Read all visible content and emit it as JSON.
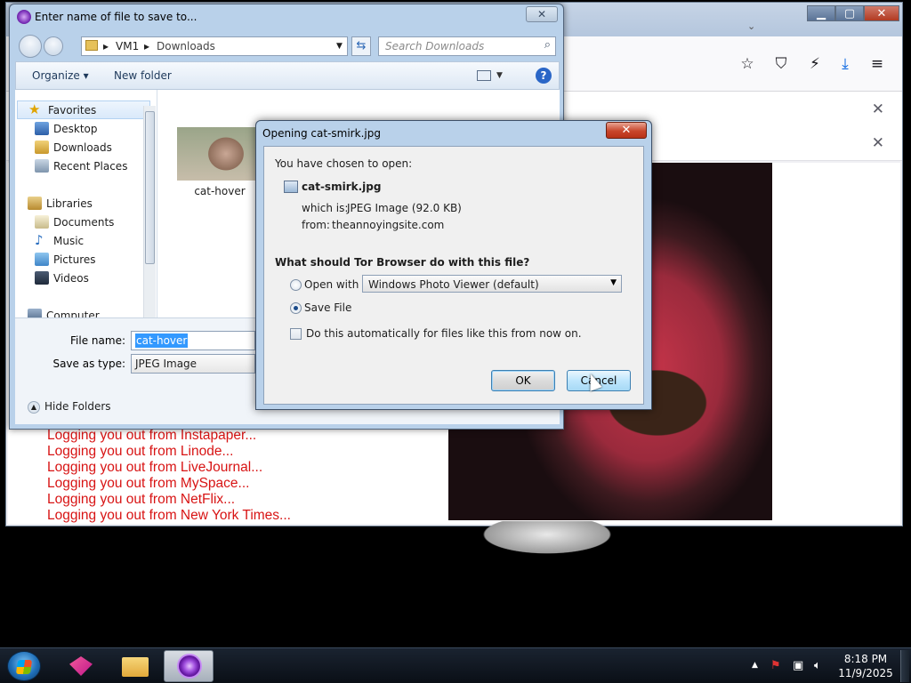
{
  "browser": {
    "toolbar_icons": [
      "star-icon",
      "shield-icon",
      "broom-icon",
      "download-icon",
      "menu-icon"
    ],
    "notification_close": "✕"
  },
  "page": {
    "log_lines": [
      "Logging you out from Instapaper...",
      "Logging you out from Linode...",
      "Logging you out from LiveJournal...",
      "Logging you out from MySpace...",
      "Logging you out from NetFlix...",
      "Logging you out from New York Times..."
    ]
  },
  "save_dialog": {
    "title": "Enter name of file to save to...",
    "breadcrumb": [
      "VM1",
      "Downloads"
    ],
    "search_placeholder": "Search Downloads",
    "organize": "Organize ▾",
    "new_folder": "New folder",
    "nav": {
      "favorites": "Favorites",
      "desktop": "Desktop",
      "downloads": "Downloads",
      "recent_places": "Recent Places",
      "libraries": "Libraries",
      "documents": "Documents",
      "music": "Music",
      "pictures": "Pictures",
      "videos": "Videos",
      "computer": "Computer"
    },
    "file_item": "cat-hover",
    "file_name_label": "File name:",
    "file_name_value": "cat-hover",
    "save_type_label": "Save as type:",
    "save_type_value": "JPEG Image",
    "hide_folders": "Hide Folders"
  },
  "open_dialog": {
    "title": "Opening cat-smirk.jpg",
    "chosen": "You have chosen to open:",
    "filename": "cat-smirk.jpg",
    "which_is_label": "which is:",
    "which_is_value": "JPEG Image (92.0 KB)",
    "from_label": "from:",
    "from_value": "theannoyingsite.com",
    "question": "What should Tor Browser do with this file?",
    "open_with_label": "Open with",
    "open_with_value": "Windows Photo Viewer (default)",
    "save_file_label": "Save File",
    "auto_label": "Do this automatically for files like this from now on.",
    "ok": "OK",
    "cancel": "Cancel",
    "selected_option": "save_file"
  },
  "taskbar": {
    "time": "8:18 PM",
    "date": "11/9/2025"
  }
}
